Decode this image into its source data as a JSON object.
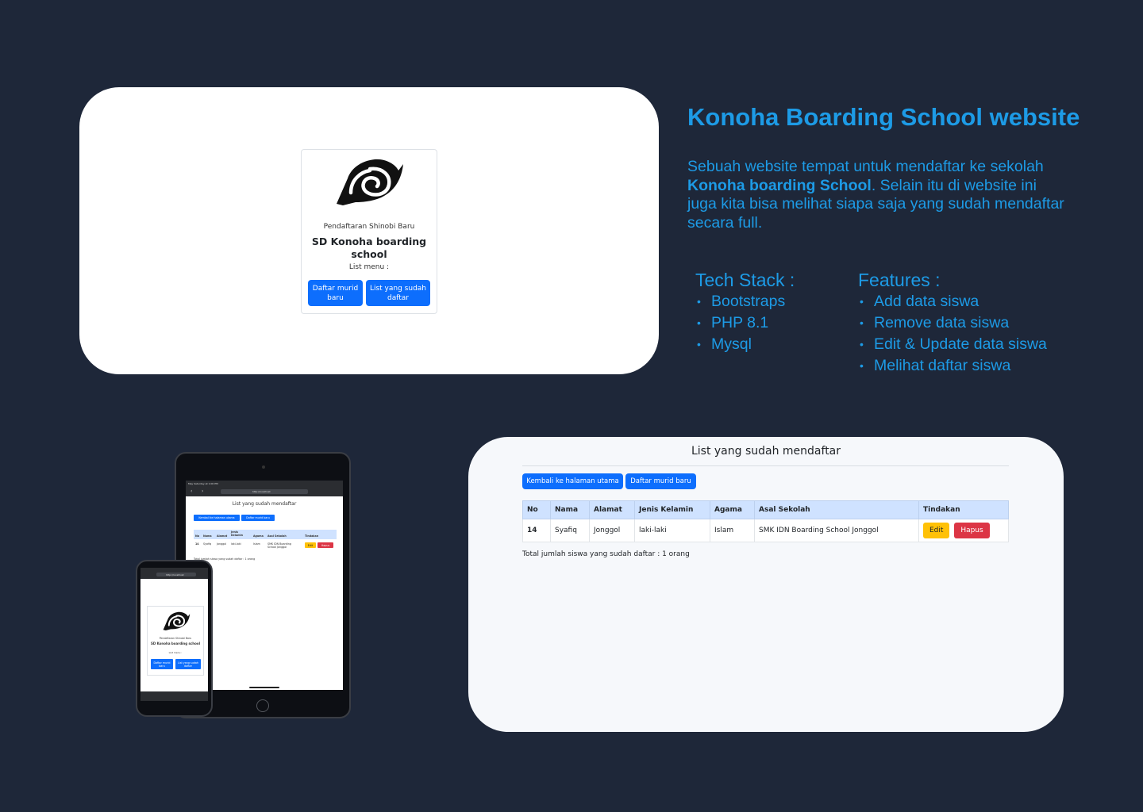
{
  "home": {
    "subtitle": "Pendaftaran Shinobi Baru",
    "title": "SD Konoha boarding school",
    "menu_label": "List menu :",
    "btn_register": "Daftar murid baru",
    "btn_list": "List yang sudah daftar"
  },
  "info": {
    "heading": "Konoha Boarding School website",
    "desc_pre": "Sebuah website tempat untuk mendaftar ke sekolah ",
    "desc_bold": "Konoha boarding School",
    "desc_post": ". Selain itu di website ini juga kita bisa melihat siapa saja yang sudah mendaftar secara full.",
    "tech_title": "Tech Stack :",
    "tech": [
      "Bootstraps",
      "PHP 8.1",
      "Mysql"
    ],
    "features_title": "Features :",
    "features": [
      "Add data siswa",
      "Remove data siswa",
      "Edit & Update data siswa",
      "Melihat daftar siswa"
    ]
  },
  "tablet": {
    "status_time": "May Saturday at 1:00 PM",
    "url": "http://localhost",
    "title": "List yang sudah mendaftar",
    "btn_back": "Kembali ke halaman utama",
    "btn_register": "Daftar murid baru",
    "headers": [
      "No",
      "Nama",
      "Alamat",
      "Jenis Kelamin",
      "Agama",
      "Asal Sekolah",
      "Tindakan"
    ],
    "row": [
      "14",
      "Syafiq",
      "Jonggol",
      "laki-laki",
      "Islam",
      "SMK IDN Boarding School Jonggol"
    ],
    "edit": "Edit",
    "delete": "Hapus",
    "total": "Total jumlah siswa yang sudah daftar : 1 orang"
  },
  "phone": {
    "url": "http://localhost",
    "subtitle": "Pendaftaran Shinobi Baru",
    "title": "SD Konoha boarding school",
    "menu_label": "List menu :",
    "btn_register": "Daftar murid baru",
    "btn_list": "List yang sudah daftar"
  },
  "list": {
    "title": "List yang sudah mendaftar",
    "btn_back": "Kembali ke halaman utama",
    "btn_register": "Daftar murid baru",
    "headers": [
      "No",
      "Nama",
      "Alamat",
      "Jenis Kelamin",
      "Agama",
      "Asal Sekolah",
      "Tindakan"
    ],
    "rows": [
      [
        "14",
        "Syafiq",
        "Jonggol",
        "laki-laki",
        "Islam",
        "SMK IDN Boarding School Jonggol"
      ]
    ],
    "edit": "Edit",
    "delete": "Hapus",
    "total": "Total jumlah siswa yang sudah daftar : 1 orang"
  },
  "colors": {
    "background": "#1e2739",
    "accent_text": "#1d9be6",
    "primary_button": "#0d6efd",
    "warning_button": "#ffc107",
    "danger_button": "#dc3545",
    "table_header": "#cfe2ff"
  }
}
